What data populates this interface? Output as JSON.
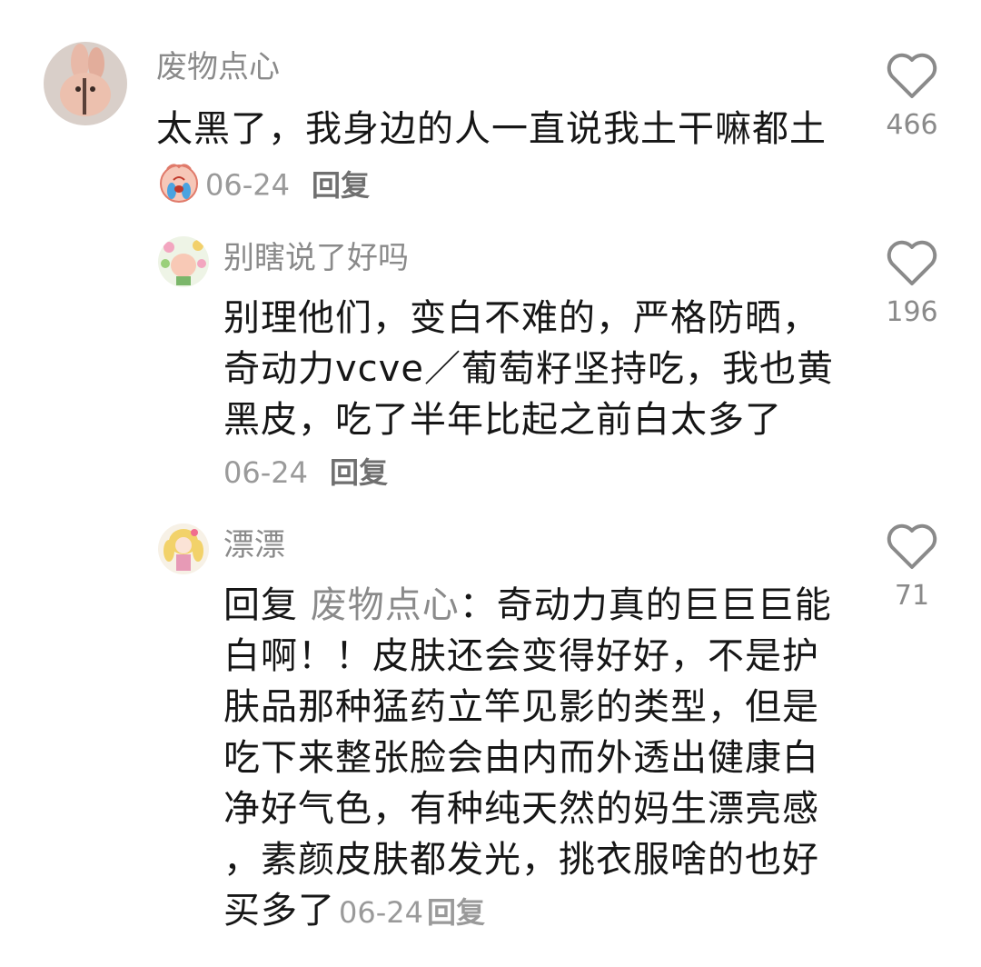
{
  "comments": [
    {
      "username": "废物点心",
      "content_lines": [
        "太黑了，我身边的人一直说我土干嘛都土"
      ],
      "date": "06-24",
      "reply_label": "回复",
      "likes": "466",
      "has_emoji": true,
      "emoji_icon": "crying-face-icon"
    },
    {
      "username": "别瞎说了好吗",
      "content_lines": [
        "别理他们，变白不难的，严格防晒，",
        "奇动力vcve／葡萄籽坚持吃，我也黄",
        "黑皮，吃了半年比起之前白太多了"
      ],
      "date": "06-24",
      "reply_label": "回复",
      "likes": "196"
    },
    {
      "username": "漂漂",
      "reply_prefix": "回复",
      "reply_target": "废物点心",
      "reply_colon": "：",
      "first_line_rest": "奇动力真的巨巨巨能",
      "content_lines": [
        "白啊！！皮肤还会变得好好，不是护",
        "肤品那种猛药立竿见影的类型，但是",
        "吃下来整张脸会由内而外透出健康白",
        "净好气色，有种纯天然的妈生漂亮感",
        "，素颜皮肤都发光，挑衣服啥的也好"
      ],
      "last_line": "买多了",
      "date": "06-24",
      "reply_label": "回复",
      "likes": "71"
    }
  ]
}
